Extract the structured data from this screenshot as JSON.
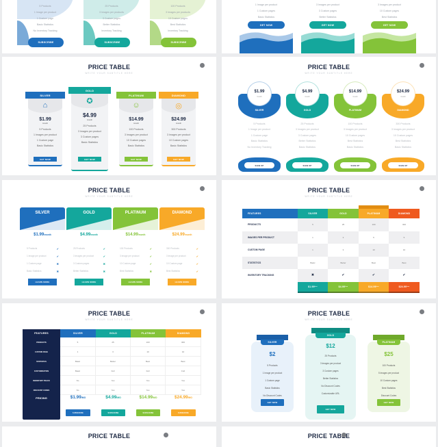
{
  "colors": {
    "blue": "#1f6fbd",
    "teal": "#14a79c",
    "green": "#84c339",
    "orange": "#f8a928",
    "red": "#ef5a1f",
    "navy": "#14234b",
    "dark_text": "#1e2a44"
  },
  "common": {
    "title": "PRICE TABLE",
    "subtitle": "WRITE YOUR SUBTITLE HERE"
  },
  "slide1": {
    "cards": [
      {
        "features": [
          "5 Products",
          "1 Image per product",
          "1 Custom page",
          "Basic Statistics",
          "No Inventory Tracking"
        ],
        "button": "SUBSCRIBE"
      },
      {
        "features": [
          "25 Products",
          "3 Images per products",
          "3 Custom pages",
          "Better Statistics",
          "Inventory Tracking"
        ],
        "button": "SUBSCRIBE"
      },
      {
        "features": [
          "100 Products",
          "3 Images per products",
          "10 Custom pages",
          "Best Statistics",
          "Inventory Tracking"
        ],
        "button": "SUBSCRIBE"
      }
    ]
  },
  "slide2": {
    "cards": [
      {
        "features": [
          "1 Image per product",
          "1 Custom pages",
          "Basic Statistics"
        ],
        "button": "GET NOW"
      },
      {
        "features": [
          "3 Images per product",
          "3 Custom pages",
          "Better Statistics"
        ],
        "button": "GET NOW"
      },
      {
        "features": [
          "3 Images per product",
          "10 Custom pages",
          "Best Statistics"
        ],
        "button": "GET NOW"
      }
    ]
  },
  "slide3": {
    "cards": [
      {
        "name": "SILVER",
        "icon": "house-icon",
        "price": "$1.99",
        "period": "/month",
        "features": [
          "5 Products",
          "1 Images per product",
          "1 Custom page",
          "Basic Statistics"
        ],
        "button": "GET NOW"
      },
      {
        "name": "GOLD",
        "icon": "award-badge-icon",
        "price": "$4.99",
        "period": "/month",
        "features": [
          "25 Products",
          "3 Images per product",
          "3 Custom pages",
          "Basic Statistics"
        ],
        "button": "GET NOW"
      },
      {
        "name": "PLATINUM",
        "icon": "handshake-icon",
        "price": "$14.99",
        "period": "/month",
        "features": [
          "100 Products",
          "3 Images per product",
          "10 Custom pages",
          "Basic Statistics"
        ],
        "button": "GET NOW"
      },
      {
        "name": "DIAMOND",
        "icon": "coins-icon",
        "price": "$24.99",
        "period": "/month",
        "features": [
          "300 Products",
          "3 Images per product",
          "10 Custom pages",
          "Basic Statistics"
        ],
        "button": "GET NOW"
      }
    ]
  },
  "slide4": {
    "cards": [
      {
        "name": "SILVER",
        "price": "$1.99",
        "period": "/month",
        "features": [
          "5 Products",
          "1 Image per product",
          "1 Custom page",
          "Basic Statistics",
          "No Inventory Tracking"
        ],
        "button": "SIGN UP"
      },
      {
        "name": "GOLD",
        "price": "$4.99",
        "period": "/month",
        "features": [
          "25 Products",
          "3 Images per product",
          "3 Custom pages",
          "Better Statistics",
          "Basic Statistics"
        ],
        "button": "SIGN UP"
      },
      {
        "name": "PLATINUM",
        "price": "$14.99",
        "period": "/month",
        "features": [
          "100 Products",
          "3 Images per product",
          "10 Custom pages",
          "Best Statistics",
          "Basic Statistics"
        ],
        "button": "SIGN UP"
      },
      {
        "name": "DIAMOND",
        "price": "$24.99",
        "period": "/month",
        "features": [
          "300 Products",
          "3 Images per product",
          "10 Custom pages",
          "Best Statistics",
          "Basic Statistics"
        ],
        "button": "SIGN UP"
      }
    ]
  },
  "slide5": {
    "cards": [
      {
        "name": "SILVER",
        "price": "$1.99",
        "period": "/month",
        "features": [
          [
            "5 Products",
            "check"
          ],
          [
            "1 Image per product",
            "check"
          ],
          [
            "1 Custom page",
            "cross"
          ],
          [
            "Basic Statistics",
            "cross"
          ]
        ],
        "button": "LEARN MORE"
      },
      {
        "name": "GOLD",
        "price": "$4.99",
        "period": "/month",
        "features": [
          [
            "25 Products",
            "check"
          ],
          [
            "3 Images per product",
            "check"
          ],
          [
            "3 Custom pages",
            "cross"
          ],
          [
            "Better Statistics",
            "cross"
          ]
        ],
        "button": "LEARN MORE"
      },
      {
        "name": "PLATINUM",
        "price": "$14.99",
        "period": "/month",
        "features": [
          [
            "100 Products",
            "check"
          ],
          [
            "3 Image per product",
            "check"
          ],
          [
            "10 Custom page",
            "check"
          ],
          [
            "Best Statistics",
            "cross"
          ]
        ],
        "button": "LEARN MORE"
      },
      {
        "name": "DIAMOND",
        "price": "$24.99",
        "period": "/month",
        "features": [
          [
            "300 Products",
            "check"
          ],
          [
            "3 Image per product",
            "check"
          ],
          [
            "10 Custom page",
            "check"
          ],
          [
            "Best Statistics",
            "check"
          ]
        ],
        "button": "LEARN MORE"
      }
    ]
  },
  "slide6": {
    "header": [
      "FEATURES",
      "SILVER",
      "GOLD",
      "PLATINUM",
      "DIAMOND"
    ],
    "rows": [
      [
        "PRODUCTS",
        "5",
        "25",
        "100",
        "300"
      ],
      [
        "IMAGES PER PRODUCT",
        "1",
        "3",
        "5",
        "5"
      ],
      [
        "CUSTOM PAGE",
        "1",
        "3",
        "10",
        "10"
      ],
      [
        "STATISTICS",
        "Basic",
        "Better",
        "Best",
        "Best"
      ],
      [
        "INVENTORY TRACKING",
        "cross",
        "check",
        "check",
        "check"
      ]
    ],
    "prices": [
      [
        "$1.99",
        "/mo"
      ],
      [
        "$4.99",
        "/mo"
      ],
      [
        "$14.99",
        "/mo"
      ],
      [
        "$24.99",
        "/mo"
      ]
    ]
  },
  "slide7": {
    "header": [
      "FEATURES",
      "SILVER",
      "GOLD",
      "PLATINUM",
      "DIAMOND"
    ],
    "rows": [
      [
        "PRODUCTS",
        "5",
        "25",
        "100",
        "300"
      ],
      [
        "CUSTOM PAGE",
        "1",
        "3",
        "10",
        "10"
      ],
      [
        "STATISTICS",
        "Basic",
        "Better",
        "Best",
        "Best"
      ],
      [
        "CUSTOMIZATION",
        "Basic",
        "Full",
        "Full",
        "Full"
      ],
      [
        "INVENTORY TRACK",
        "No",
        "Yes",
        "Yes",
        "Yes"
      ],
      [
        "DISCOUNT CODES",
        "No",
        "Yes",
        "Yes",
        "Yes"
      ]
    ],
    "pricing_label": "PRICING",
    "prices": [
      [
        "$1.99",
        "/MO"
      ],
      [
        "$4.99",
        "/MO"
      ],
      [
        "$14.99",
        "/MO"
      ],
      [
        "$24.99",
        "/MO"
      ]
    ],
    "button": "SUBSCRIBE"
  },
  "slide8": {
    "cards": [
      {
        "name": "SILVER",
        "price": "$2",
        "features": [
          "5 Products",
          "1 Image per product",
          "1 Custom page",
          "Basic Statistics",
          "No Discount Codes"
        ],
        "button": "GET NOW"
      },
      {
        "name": "GOLD",
        "price": "$12",
        "features": [
          "25 Products",
          "3 Images per product",
          "3 Custom pages",
          "Better Statistics",
          "No Discount Codes",
          "Customizable URL"
        ],
        "button": "GET NOW"
      },
      {
        "name": "PLATINUM",
        "price": "$25",
        "features": [
          "100 Products",
          "5 Images per product",
          "10 Custom pages",
          "Best Statistics",
          "Discount Codes"
        ],
        "button": "GET NOW"
      }
    ]
  }
}
